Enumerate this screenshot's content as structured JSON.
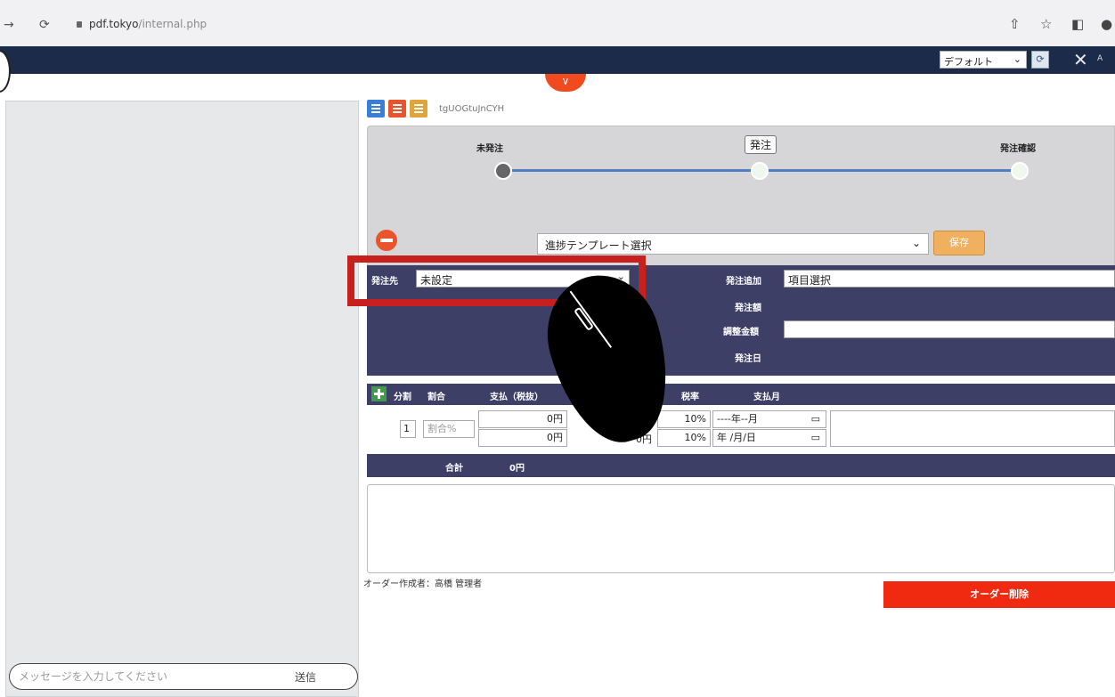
{
  "browser": {
    "url_host": "pdf.tokyo",
    "url_path": "/internal.php"
  },
  "header": {
    "template_select_value": "デフォルト",
    "logo_text": "A"
  },
  "main": {
    "order_id": "tgUOGtuJnCYH",
    "stages": [
      "未発注",
      "発注",
      "発注確認"
    ],
    "progress_template_placeholder": "進捗テンプレート選択",
    "save_label": "保存",
    "order_panel": {
      "supplier_label": "発注先",
      "supplier_value": "未設定",
      "add_label": "発注追加",
      "add_value": "項目選択",
      "order_amount_label": "発注額",
      "adjust_label": "調整金額",
      "order_date_label": "発注日"
    },
    "split_headers": [
      "分割",
      "割合",
      "支払（税抜）",
      "税率",
      "支払月"
    ],
    "split_row": {
      "index": "1",
      "ratio_placeholder": "割合%",
      "pay_excl": "0円",
      "pay_incl": "0円",
      "tax1": "0円",
      "tax2": "0円",
      "rate1": "10%",
      "rate2": "10%",
      "month_placeholder": "----年--月",
      "date_placeholder": "年 /月/日"
    },
    "total_label": "合計",
    "total_value": "0円",
    "creator": "オーダー作成者：高橋 管理者",
    "delete_label": "オーダー削除"
  },
  "sidebar": {
    "message_placeholder": "メッセージを入力してください",
    "send_label": "送信"
  },
  "colors": {
    "navbar": "#1d2b4a",
    "panel": "#3d3f66",
    "accent_orange": "#f04a1e",
    "delete_red": "#f02a10",
    "highlight_red": "#c81f1f"
  }
}
